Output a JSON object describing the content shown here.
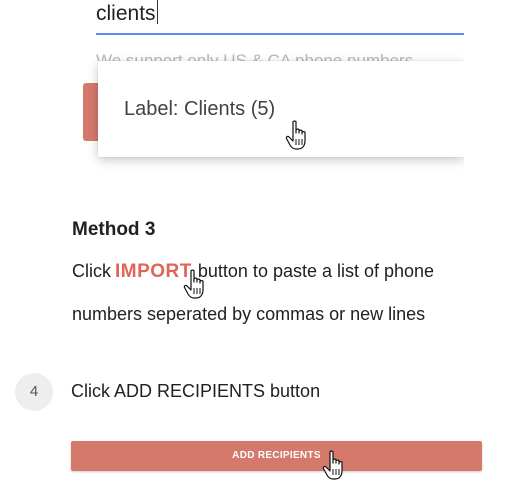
{
  "search": {
    "value": "clients",
    "helper_text": "We support only US & CA phone numbers"
  },
  "dropdown": {
    "item_label": "Label: Clients (5)"
  },
  "method3": {
    "title": "Method 3",
    "line1_prefix": "Click",
    "import_label": "IMPORT",
    "line1_suffix": "button to paste a list of phone",
    "line2": "numbers seperated by commas or new lines"
  },
  "step4": {
    "number": "4",
    "text": "Click ADD RECIPIENTS button"
  },
  "add_button": {
    "label": "ADD RECIPIENTS"
  },
  "colors": {
    "accent": "#d5796c",
    "import": "#e06557",
    "underline": "#5b8ff0"
  }
}
